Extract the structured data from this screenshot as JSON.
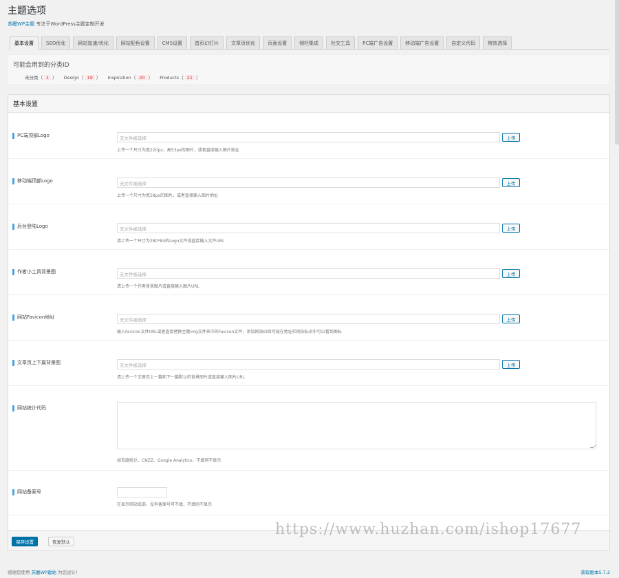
{
  "header": {
    "title": "主题选项",
    "subtitle_link": "苏醒WP主题",
    "subtitle_text": "专注于WordPress主题定制开发"
  },
  "tabs": [
    {
      "label": "基本设置",
      "active": true
    },
    {
      "label": "SEO优化"
    },
    {
      "label": "网站加速/优化"
    },
    {
      "label": "网站配色设置"
    },
    {
      "label": "CMS设置"
    },
    {
      "label": "首页幻灯片"
    },
    {
      "label": "文章页优化"
    },
    {
      "label": "页面设置"
    },
    {
      "label": "侧栏集成"
    },
    {
      "label": "社交工具"
    },
    {
      "label": "PC端广告设置"
    },
    {
      "label": "移动端广告设置"
    },
    {
      "label": "自定义代码"
    },
    {
      "label": "特效选择"
    }
  ],
  "categories": {
    "title": "可能会用到的分类ID",
    "items": [
      {
        "name": "未分类",
        "id": "1"
      },
      {
        "name": "Design",
        "id": "19"
      },
      {
        "name": "Inspiration",
        "id": "20"
      },
      {
        "name": "Products",
        "id": "21"
      }
    ]
  },
  "panel": {
    "heading": "基本设置",
    "placeholder": "无文件被选择",
    "upload_label": "上传",
    "fields": [
      {
        "label": "PC端顶部Logo",
        "desc": "上传一个尺寸为宽220px，高53px的图片，或者直接输入图片地址"
      },
      {
        "label": "移动端顶部Logo",
        "desc": "上传一个尺寸为宽58px的图片，或者直接输入图片地址"
      },
      {
        "label": "后台登陆Logo",
        "desc": "请上传一个尺寸为280*84的Logo文件或直接输入文件URL"
      },
      {
        "label": "作者小工具背景图",
        "desc": "请上传一个作者背景图片或直接输入图片URL"
      },
      {
        "label": "网站Favicon地址",
        "desc": "输入Favicon文件URL或者直接替换主题img文件夹中的Favicon文件，添加网站ID后可能在地址栏网站标识中可以看到图标"
      },
      {
        "label": "文章页上下篇背景图",
        "desc": "请上传一个文章页上一篇和下一篇默认的背景图片或直接输入图片URL"
      }
    ],
    "stats_label": "网站统计代码",
    "stats_desc": "如百度统计、CNZZ、Google Analytics，不填则不显示",
    "icp_label": "网站备案号",
    "icp_desc": "在显示网站底部，没有备案号可不填，不填则不显示"
  },
  "actions": {
    "save": "保存设置",
    "reset": "恢复默认"
  },
  "watermark": "https://www.huzhan.com/ishop17677",
  "footer": {
    "left_text": "感谢您使用",
    "left_link": "苏醒WP建站",
    "left_suffix": "为您设计！",
    "version": "获取版本5.7.2"
  }
}
